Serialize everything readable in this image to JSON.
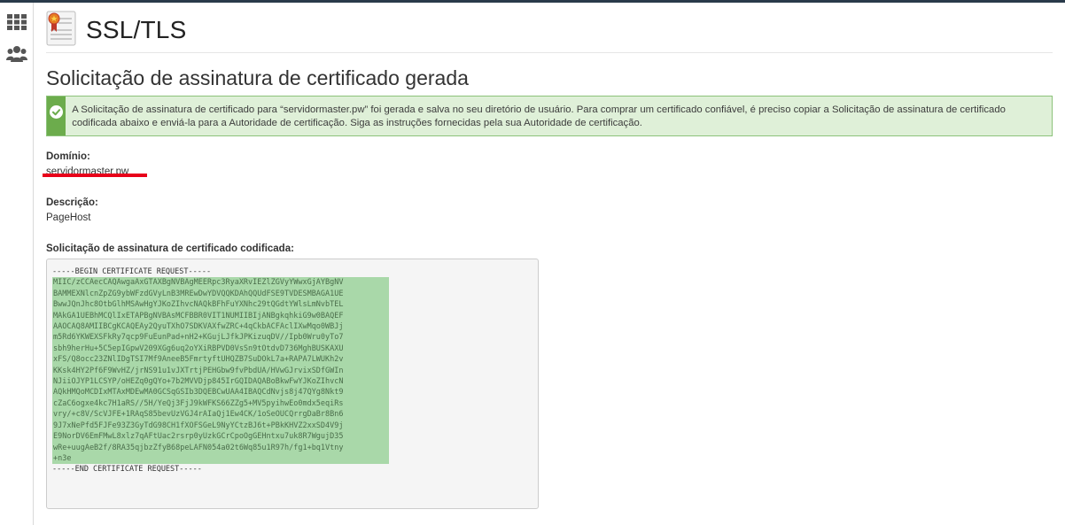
{
  "page": {
    "title": "SSL/TLS",
    "section_title": "Solicitação de assinatura de certificado gerada"
  },
  "sidebar": {
    "items": [
      {
        "name": "apps-grid",
        "icon": "grid-icon"
      },
      {
        "name": "users",
        "icon": "users-icon"
      }
    ]
  },
  "alert": {
    "icon": "check-circle-icon",
    "text": "A Solicitação de assinatura de certificado para “servidormaster.pw” foi gerada e salva no seu diretório de usuário. Para comprar um certificado confiável, é preciso copiar a Solicitação de assinatura de certificado codificada abaixo e enviá-la para a Autoridade de certificação. Siga as instruções fornecidas pela sua Autoridade de certificação."
  },
  "domain": {
    "label": "Domínio:",
    "value": "servidormaster.pw"
  },
  "description": {
    "label": "Descrição:",
    "value": "PageHost"
  },
  "csr": {
    "label": "Solicitação de assinatura de certificado codificada:",
    "begin": "-----BEGIN CERTIFICATE REQUEST-----",
    "end": "-----END CERTIFICATE REQUEST-----",
    "lines": [
      "MIIC/zCCAecCAQAwgaAxGTAXBgNVBAgMEERpc3RyaXRvIEZlZGVyYWwxGjAYBgNV",
      "BAMMEXNlcnZpZG9ybWFzdGVyLnB3MREwDwYDVQQKDAhQQUdFSE9TVDESMBAGA1UE",
      "BwwJQnJhc8OtbGlhMSAwHgYJKoZIhvcNAQkBFhFuYXNhc29tQGdtYWlsLmNvbTEL",
      "MAkGA1UEBhMCQlIxETAPBgNVBAsMCFBBR0VIT1NUMIIBIjANBgkqhkiG9w0BAQEF",
      "AAOCAQ8AMIIBCgKCAQEAy2QyuTXhO7SDKVAXfwZRC+4qCkbACFAclIXwMqo0WBJj",
      "m5Rd6YKWEXSFkRy7qcp9FuEunPad+nH2+KGujLJfkJPKizuqDV//Ipb0Wru0yTo7",
      "sbh9herHu+5C5epIGpwV209XGg6uq2oYXiRBPVD0VsSn9tOtdvD736MghBUSKAXU",
      "xFS/Q8occ23ZNlIDgTSI7Mf9AneeB5FmrtyftUHQZB7SuDOkL7a+RAPA7LWUKh2v",
      "KKsk4HY2Pf6F9WvHZ/jrNS91u1vJXTrtjPEHGbw9fvPbdUA/HVwGJrvixSDfGWIn",
      "NJiiOJYP1LCSYP/oHEZq0gQYo+7b2MVVDjp845IrGQIDAQABoBkwFwYJKoZIhvcN",
      "AQkHMQoMCDIxMTAxMDEwMA0GCSqGSIb3DQEBCwUAA4IBAQCdNvjs8j47QYg8Nkt9",
      "cZaC6ogxe4kc7H1aRS//5H/YeQj3FjJ9kWFKS66ZZg5+MV5pyihwEo0mdx5eqiRs",
      "vry/+c8V/ScVJFE+1RAqS85bevUzVGJ4rAIaQj1Ew4CK/1oSeOUCQrrgDaBr8Bn6",
      "9J7xNePfd5FJFe93Z3GyTdG98CH1fXOFSGeL9NyYCtzBJ6t+PBkKHVZ2xxSD4V9j",
      "E9NorDV6EmFMwL8xlz7qAFtUac2rsrp0yUzkGCrCpoOgGEHntxu7uk8R7WgujD35",
      "wRe+uugAeB2f/8RA35qjbzZfyB68peLAFN054a02t6Wq85u1R97h/fg1+bq1Vtny",
      "+n3e"
    ]
  }
}
